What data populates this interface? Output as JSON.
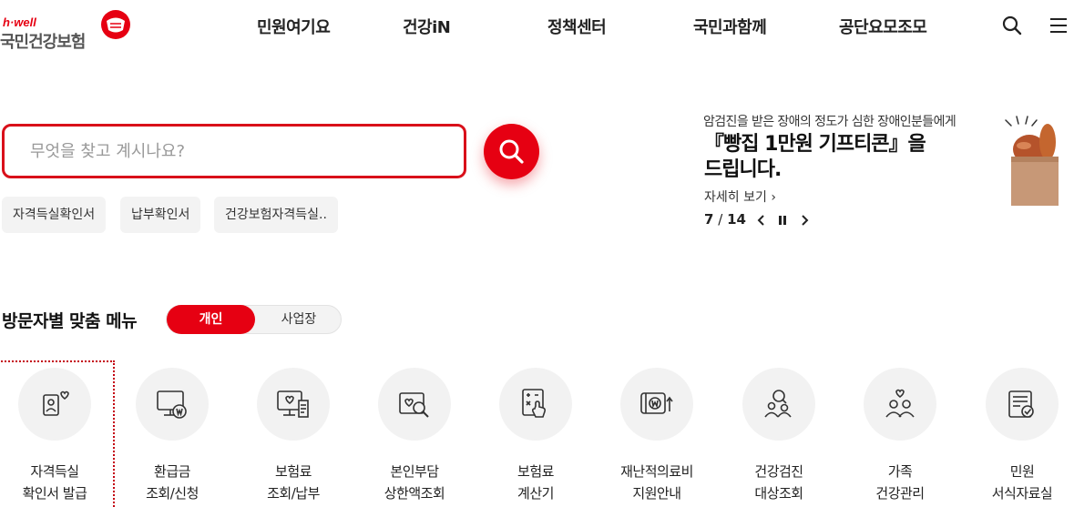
{
  "header": {
    "logo_tagline": "h·well",
    "logo_name": "국민건강보험",
    "nav": [
      "민원여기요",
      "건강iN",
      "정책센터",
      "국민과함께",
      "공단요모조모"
    ]
  },
  "search": {
    "placeholder": "무엇을 찾고 계시나요?",
    "quick_links": [
      "자격득실확인서",
      "납부확인서",
      "건강보험자격득실.."
    ]
  },
  "banner": {
    "subtitle": "암검진을 받은 장애의 정도가 심한 장애인분들에게",
    "title_line1": "『빵집 1만원 기프티콘』을",
    "title_line2": "드립니다.",
    "more_label": "자세히 보기",
    "current": "7",
    "separator": "/",
    "total": "14"
  },
  "visitor_menu": {
    "title": "방문자별 맞춤 메뉴",
    "toggle_active": "개인",
    "toggle_inactive": "사업장",
    "items": [
      {
        "line1": "자격득실",
        "line2": "확인서 발급",
        "icon": "id-card-heart-icon"
      },
      {
        "line1": "환급금",
        "line2": "조회/신청",
        "icon": "monitor-won-icon"
      },
      {
        "line1": "보험료",
        "line2": "조회/납부",
        "icon": "monitor-receipt-icon"
      },
      {
        "line1": "본인부담",
        "line2": "상한액조회",
        "icon": "heart-magnifier-icon"
      },
      {
        "line1": "보험료",
        "line2": "계산기",
        "icon": "calculator-hand-icon"
      },
      {
        "line1": "재난적의료비",
        "line2": "지원안내",
        "icon": "wallet-won-icon"
      },
      {
        "line1": "건강검진",
        "line2": "대상조회",
        "icon": "people-search-icon"
      },
      {
        "line1": "가족",
        "line2": "건강관리",
        "icon": "family-heart-icon"
      },
      {
        "line1": "민원",
        "line2": "서식자료실",
        "icon": "document-check-icon"
      }
    ]
  },
  "colors": {
    "brand_red": "#e60012",
    "text_dark": "#222222",
    "chip_bg": "#f3f3f3"
  }
}
